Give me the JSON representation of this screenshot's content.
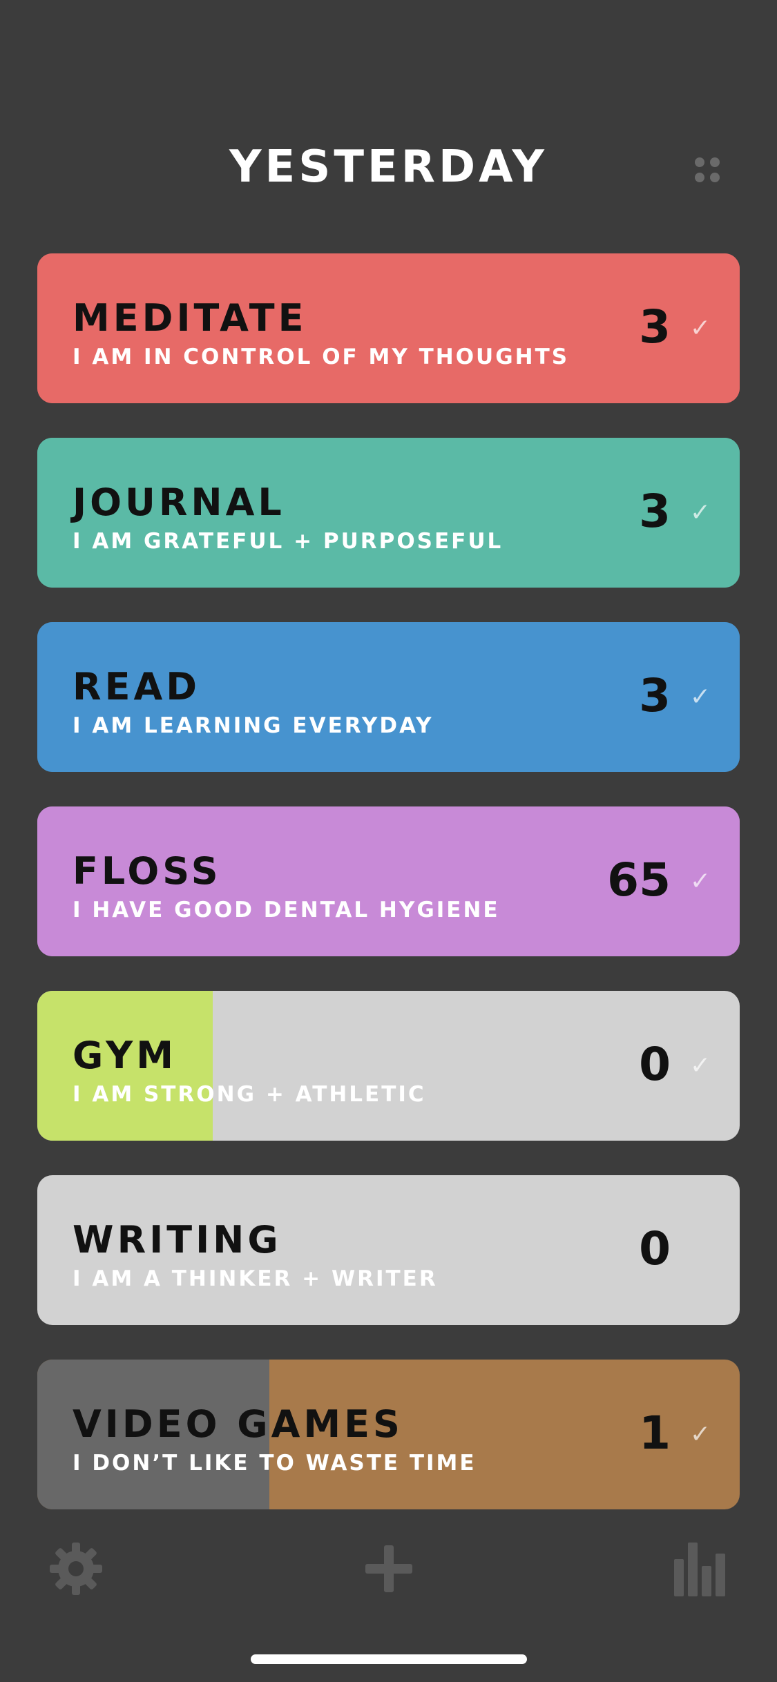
{
  "header": {
    "title": "YESTERDAY",
    "grid_icon": "grid-dots-icon"
  },
  "habits": [
    {
      "name": "MEDITATE",
      "affirmation": "I AM IN CONTROL OF MY THOUGHTS",
      "count": "3",
      "check": "✓",
      "color": "#e76a67",
      "base_color": "#e76a67",
      "fill_percent": 100
    },
    {
      "name": "JOURNAL",
      "affirmation": "I AM GRATEFUL + PURPOSEFUL",
      "count": "3",
      "check": "✓",
      "color": "#5bbaa6",
      "base_color": "#5bbaa6",
      "fill_percent": 100
    },
    {
      "name": "READ",
      "affirmation": "I AM LEARNING EVERYDAY",
      "count": "3",
      "check": "✓",
      "color": "#4793cf",
      "base_color": "#4793cf",
      "fill_percent": 100
    },
    {
      "name": "FLOSS",
      "affirmation": "I HAVE GOOD DENTAL HYGIENE",
      "count": "65",
      "check": "✓",
      "color": "#c88ad7",
      "base_color": "#c88ad7",
      "fill_percent": 100
    },
    {
      "name": "GYM",
      "affirmation": "I AM STRONG + ATHLETIC",
      "count": "0",
      "check": "✓",
      "color": "#c6e26a",
      "base_color": "#d2d2d2",
      "fill_percent": 25
    },
    {
      "name": "WRITING",
      "affirmation": "I AM A THINKER + WRITER",
      "count": "0",
      "check": "",
      "color": "#d2d2d2",
      "base_color": "#d2d2d2",
      "fill_percent": 0
    },
    {
      "name": "VIDEO GAMES",
      "affirmation": "I DON’T LIKE TO WASTE TIME",
      "count": "1",
      "check": "✓",
      "color": "#686868",
      "base_color": "#a87a4b",
      "fill_percent": 33
    }
  ],
  "toolbar": {
    "settings_icon": "gear-icon",
    "add_icon": "plus-icon",
    "stats_icon": "bar-chart-icon"
  }
}
